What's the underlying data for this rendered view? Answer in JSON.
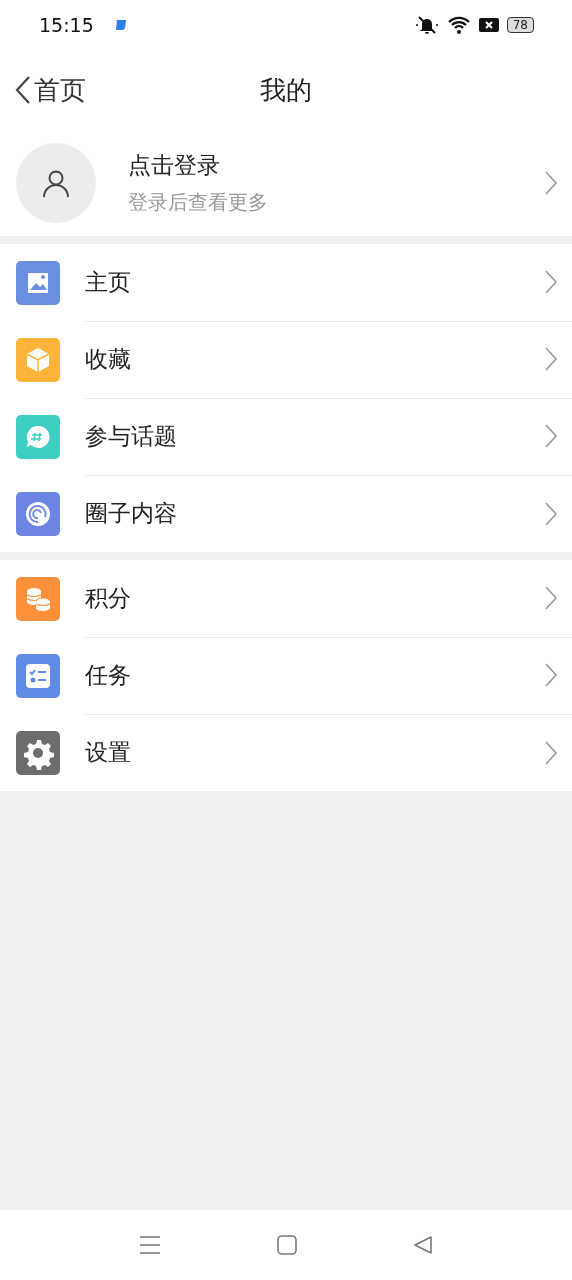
{
  "status_bar": {
    "time": "15:15",
    "battery": "78"
  },
  "nav": {
    "back": "首页",
    "title": "我的"
  },
  "profile": {
    "name": "点击登录",
    "subtitle": "登录后查看更多"
  },
  "groups": [
    {
      "items": [
        {
          "label": "主页",
          "kind": "image",
          "color": "#6a8fe0"
        },
        {
          "label": "收藏",
          "kind": "cube",
          "color": "#fdb43a"
        },
        {
          "label": "参与话题",
          "kind": "topic",
          "color": "#3ecfc4"
        },
        {
          "label": "圈子内容",
          "kind": "spiral",
          "color": "#6c85e4"
        }
      ]
    },
    {
      "items": [
        {
          "label": "积分",
          "kind": "coins",
          "color": "#fd903a"
        },
        {
          "label": "任务",
          "kind": "tasks",
          "color": "#5f8ae6"
        },
        {
          "label": "设置",
          "kind": "gear",
          "color": "#6d6d6d"
        }
      ]
    }
  ]
}
